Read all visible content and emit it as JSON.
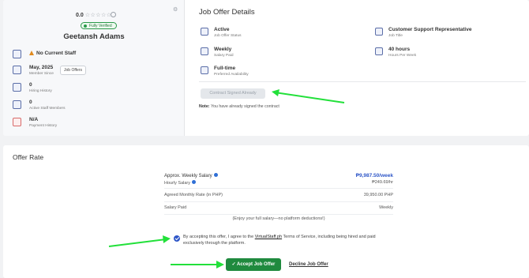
{
  "profile": {
    "rating": "0.0",
    "stars": "☆☆☆☆☆",
    "verified_label": "Fully Verified",
    "name": "Geetansh Adams",
    "current_staff": "No Current Staff",
    "member_since_value": "May, 2025",
    "member_since_label": "Member Since",
    "job_offers_button": "Job Offers",
    "hiring_history_value": "0",
    "hiring_history_label": "Hiring History",
    "active_staff_value": "0",
    "active_staff_label": "Active Staff Members",
    "payment_history_value": "N/A",
    "payment_history_label": "Payment History"
  },
  "job_offer": {
    "title": "Job Offer Details",
    "status_value": "Active",
    "status_label": "Job Offer Status",
    "job_title_value": "Customer Support Representative",
    "job_title_label": "Job Title",
    "salary_paid_value": "Weekly",
    "salary_paid_label": "Salary Paid",
    "hours_value": "40 hours",
    "hours_label": "Hours Per Week",
    "availability_value": "Full-time",
    "availability_label": "Preferred Availability",
    "contract_button": "Contract Signed Already",
    "note_prefix": "Note:",
    "note_text": "You have already signed the contract"
  },
  "offer_rate": {
    "title": "Offer Rate",
    "weekly_label": "Approx. Weekly Salary",
    "weekly_value": "₱9,987.50/week",
    "hourly_label": "Hourly Salary",
    "hourly_value": "₱249.69/hr",
    "monthly_label": "Agreed Monthly Rate (in PHP)",
    "monthly_value": "39,950.00 PHP",
    "salary_paid_label": "Salary Paid",
    "salary_paid_value": "Weekly",
    "enjoy_text": "(Enjoy your full salary—no platform deductions!)",
    "agree_prefix": "By accepting this offer, I agree to the",
    "agree_link": "VirtualStaff.ph",
    "agree_suffix": "Terms of Service, including being hired and paid exclusively through the platform.",
    "accept_button": "✓ Accept Job Offer",
    "decline_link": "Decline Job Offer"
  },
  "colors": {
    "accent_green": "#1f8a3e",
    "arrow_green": "#22e03a",
    "link_blue": "#2f57c8"
  }
}
